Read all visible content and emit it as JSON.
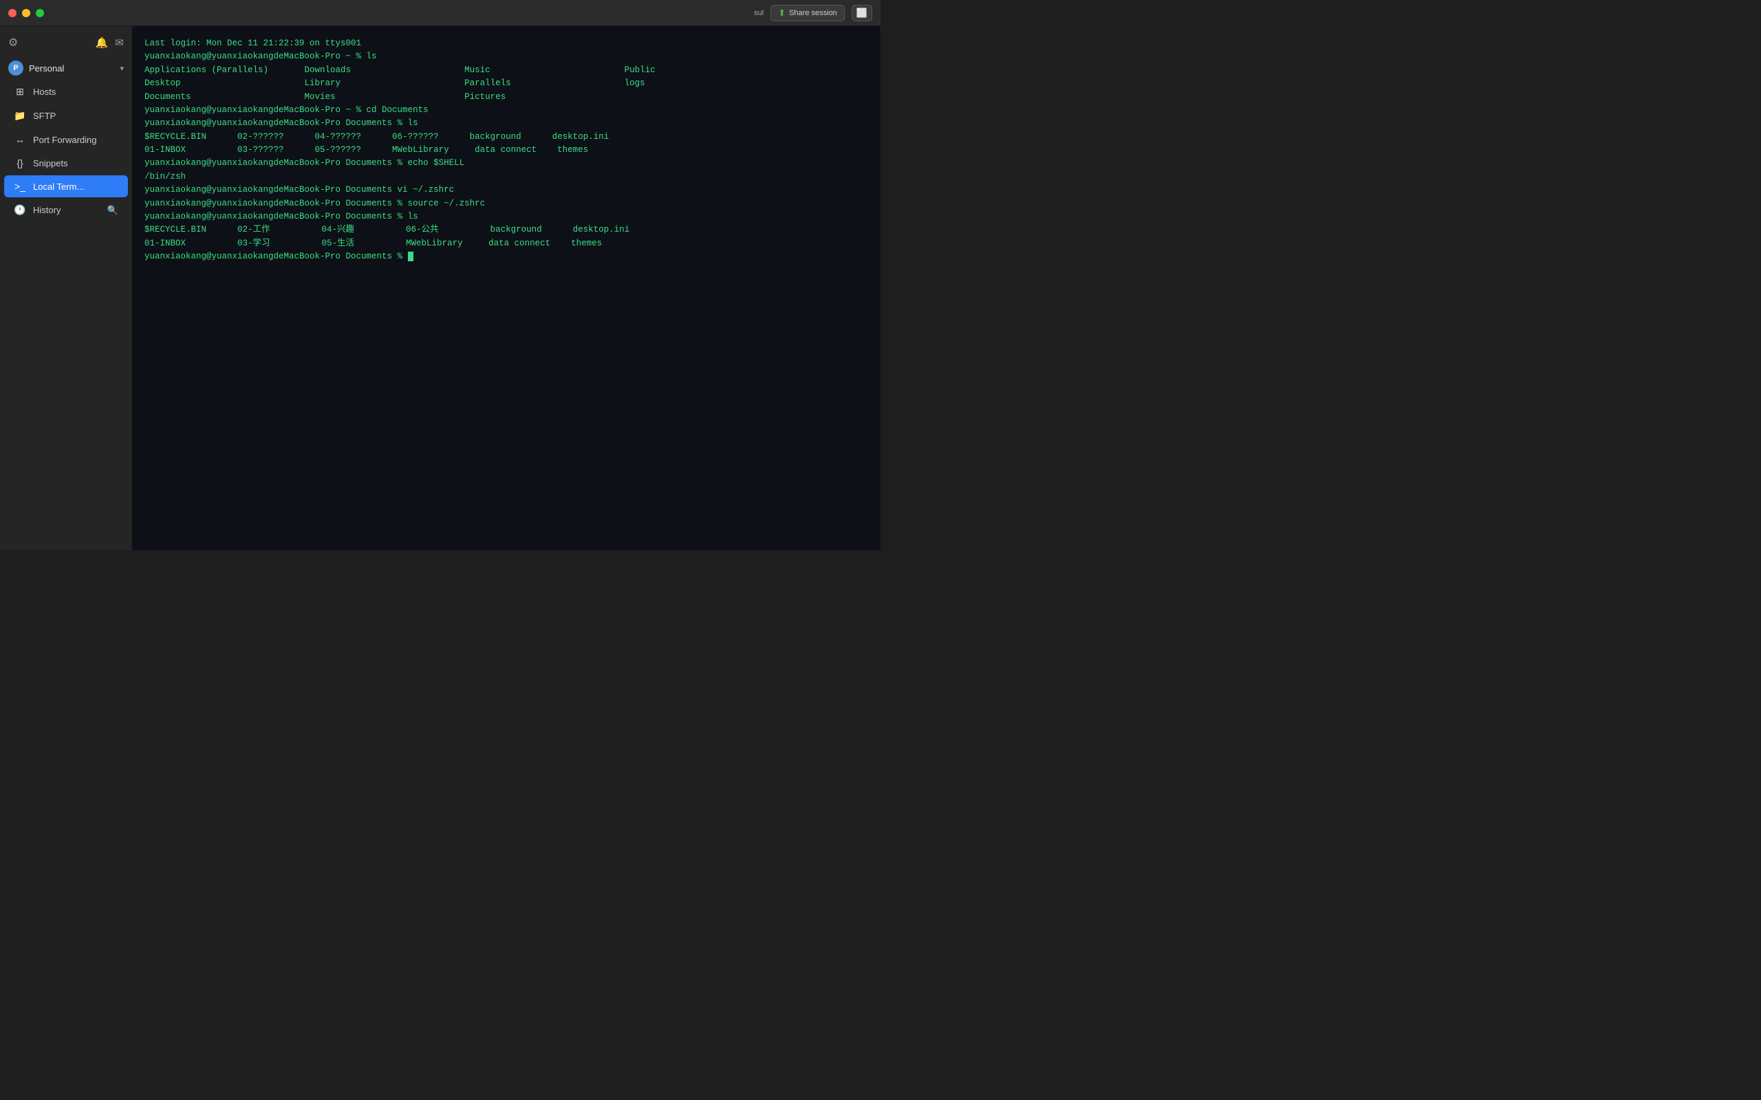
{
  "titlebar": {
    "traffic_lights": [
      "close",
      "minimize",
      "maximize"
    ],
    "share_session_label": "Share session",
    "user_label": "sul"
  },
  "sidebar": {
    "gear_icon": "⚙",
    "notification_icon": "🔔",
    "compose_icon": "✉",
    "group": {
      "avatar_text": "P",
      "label": "Personal",
      "chevron": "▾"
    },
    "items": [
      {
        "id": "hosts",
        "icon": "⊞",
        "label": "Hosts",
        "active": false
      },
      {
        "id": "sftp",
        "icon": "📁",
        "label": "SFTP",
        "active": false
      },
      {
        "id": "port-forwarding",
        "icon": "↔",
        "label": "Port Forwarding",
        "active": false
      },
      {
        "id": "snippets",
        "icon": "{}",
        "label": "Snippets",
        "active": false
      },
      {
        "id": "local-term",
        "icon": ">_",
        "label": "Local Term...",
        "active": true
      }
    ],
    "history": {
      "label": "History",
      "search_icon": "🔍"
    }
  },
  "terminal": {
    "lines": [
      "Last login: Mon Dec 11 21:22:39 on ttys001",
      "yuanxiaokang@yuanxiaokangdeMacBook-Pro ~ % ls",
      "Applications (Parallels)       Downloads                      Music                          Public",
      "Desktop                        Library                        Parallels                      logs",
      "Documents                      Movies                         Pictures",
      "yuanxiaokang@yuanxiaokangdeMacBook-Pro ~ % cd Documents",
      "yuanxiaokang@yuanxiaokangdeMacBook-Pro Documents % ls",
      "$RECYCLE.BIN      02-??????      04-??????      06-??????      background      desktop.ini",
      "01-INBOX          03-??????      05-??????      MWebLibrary     data connect    themes",
      "yuanxiaokang@yuanxiaokangdeMacBook-Pro Documents % echo $SHELL",
      "",
      "/bin/zsh",
      "yuanxiaokang@yuanxiaokangdeMacBook-Pro Documents vi ~/.zshrc",
      "yuanxiaokang@yuanxiaokangdeMacBook-Pro Documents % source ~/.zshrc",
      "yuanxiaokang@yuanxiaokangdeMacBook-Pro Documents % ls",
      "$RECYCLE.BIN      02-工作          04-兴趣          06-公共          background      desktop.ini",
      "01-INBOX          03-学习          05-生活          MWebLibrary     data connect    themes",
      "yuanxiaokang@yuanxiaokangdeMacBook-Pro Documents % "
    ]
  }
}
